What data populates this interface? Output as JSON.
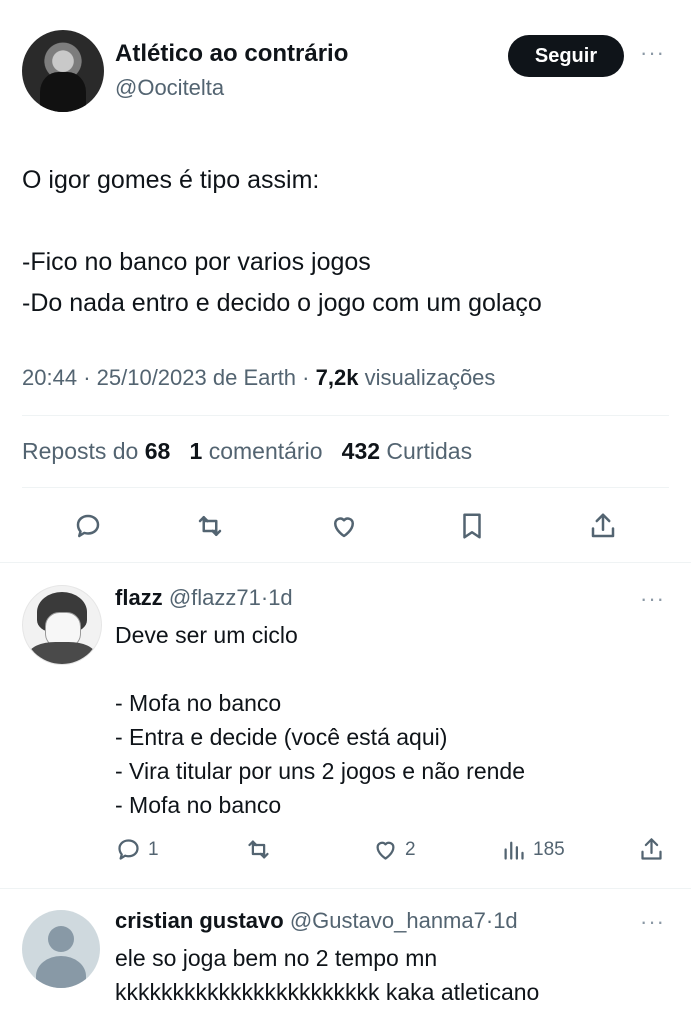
{
  "tweet": {
    "author": {
      "display_name": "Atlético ao contrário",
      "handle": "@Oocitelta"
    },
    "follow_label": "Seguir",
    "more_label": "···",
    "text_lines": [
      "O igor gomes é tipo assim:",
      "",
      "-Fico no banco por varios jogos",
      "-Do nada entro e decido o jogo com um golaço"
    ],
    "meta": {
      "time": "20:44",
      "date": "25/10/2023",
      "source": "de Earth",
      "views_count": "7,2k",
      "views_label": "visualizações"
    },
    "stats": {
      "reposts_label": "Reposts do",
      "reposts_count": "68",
      "comments_count": "1",
      "comments_label": "comentário",
      "likes_count": "432",
      "likes_label": "Curtidas"
    },
    "actions": [
      "reply-icon",
      "retweet-icon",
      "like-icon",
      "bookmark-icon",
      "share-icon"
    ]
  },
  "replies": [
    {
      "display_name": "flazz",
      "handle": "@flazz71",
      "time": "1d",
      "text_lines": [
        "Deve ser um ciclo",
        "",
        "- Mofa no banco",
        "- Entra e decide (você está aqui)",
        "- Vira titular por uns 2 jogos e não rende",
        "- Mofa no banco"
      ],
      "reply_count": "1",
      "retweet_count": "",
      "like_count": "2",
      "view_count": "185"
    },
    {
      "display_name": "cristian gustavo",
      "handle": "@Gustavo_hanma7",
      "time": "1d",
      "text_lines": [
        "ele so joga bem no 2 tempo mn",
        "kkkkkkkkkkkkkkkkkkkkkkk kaka atleticano"
      ]
    }
  ],
  "colors": {
    "text": "#0f1419",
    "secondary": "#536471",
    "divider": "#eff3f4",
    "button_bg": "#0f1419"
  }
}
